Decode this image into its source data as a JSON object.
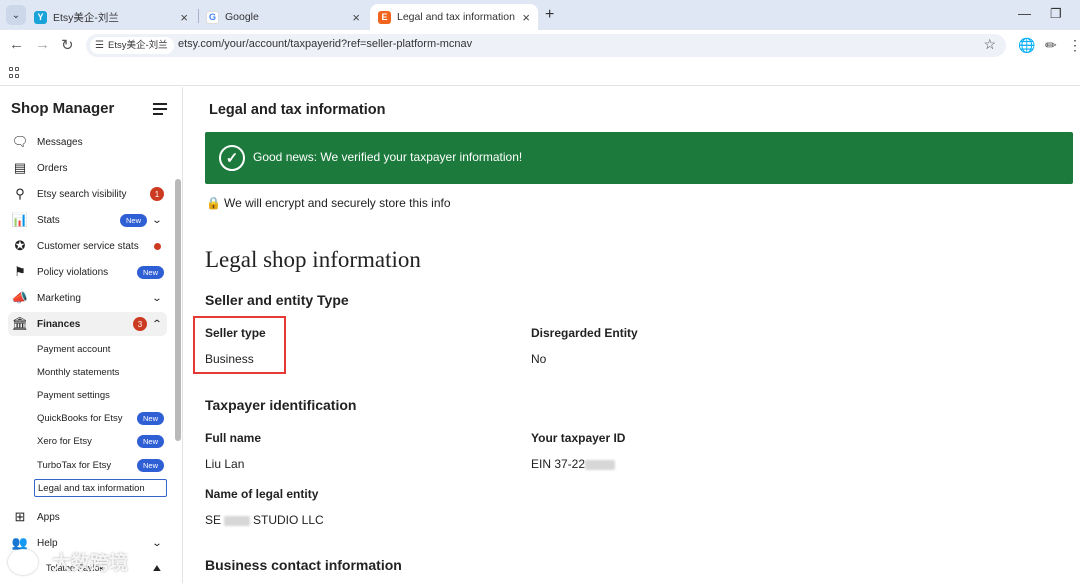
{
  "browser": {
    "tabs": [
      {
        "title": "Etsy美企-刘兰",
        "favicon_color": "#1aa3d8",
        "favicon_glyph": "Y"
      },
      {
        "title": "Google",
        "favicon_color": "#ffffff",
        "favicon_glyph": "G"
      },
      {
        "title": "Legal and tax information - E",
        "favicon_color": "#f1641e",
        "favicon_glyph": "E"
      }
    ],
    "active_tab": 2,
    "site_chip": "Etsy美企-刘兰",
    "url": "etsy.com/your/account/taxpayerid?ref=seller-platform-mcnav"
  },
  "sidebar": {
    "title": "Shop Manager",
    "items": [
      {
        "label": "Messages",
        "icon": "chat-bubble-icon"
      },
      {
        "label": "Orders",
        "icon": "receipt-icon"
      },
      {
        "label": "Etsy search visibility",
        "icon": "search-icon",
        "count": "1"
      },
      {
        "label": "Stats",
        "icon": "bar-chart-icon",
        "badge": "New"
      },
      {
        "label": "Customer service stats",
        "icon": "star-badge-icon"
      },
      {
        "label": "Policy violations",
        "icon": "flag-icon",
        "badge": "New"
      },
      {
        "label": "Marketing",
        "icon": "megaphone-icon"
      },
      {
        "label": "Finances",
        "icon": "bank-icon",
        "count": "3"
      }
    ],
    "finances_sub": [
      {
        "label": "Payment account"
      },
      {
        "label": "Monthly statements"
      },
      {
        "label": "Payment settings"
      },
      {
        "label": "QuickBooks for Etsy",
        "badge": "New"
      },
      {
        "label": "Xero for Etsy",
        "badge": "New"
      },
      {
        "label": "TurboTax for Etsy",
        "badge": "New"
      },
      {
        "label": "Legal and tax information"
      }
    ],
    "bottom_items": [
      {
        "label": "Apps",
        "icon": "grid-icon"
      },
      {
        "label": "Help",
        "icon": "people-icon"
      }
    ],
    "footer_partial": "Tolatno Favlok"
  },
  "main": {
    "title": "Legal and tax information",
    "banner": "Good news: We verified your taxpayer information!",
    "banner_color": "#1c7a3c",
    "encrypt_note": "We will encrypt and securely store this info",
    "legal_heading": "Legal shop information",
    "seller_section": "Seller and entity Type",
    "seller_type_label": "Seller type",
    "seller_type_value": "Business",
    "disregarded_label": "Disregarded Entity",
    "disregarded_value": "No",
    "taxpayer_section": "Taxpayer identification",
    "full_name_label": "Full name",
    "full_name_value": "Liu Lan",
    "taxpayer_id_label": "Your taxpayer ID",
    "taxpayer_id_value": "EIN 37-22",
    "legal_entity_label": "Name of legal entity",
    "legal_entity_prefix": "SE",
    "legal_entity_suffix": "STUDIO LLC",
    "contact_section": "Business contact information"
  },
  "watermark": "大数跨境"
}
